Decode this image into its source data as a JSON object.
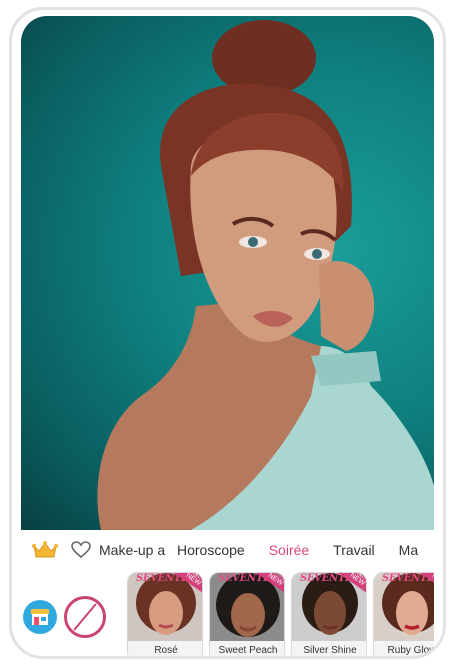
{
  "categories": {
    "tabs": [
      {
        "label": "Make-up artist",
        "active": false
      },
      {
        "label": "Horoscope",
        "active": false
      },
      {
        "label": "Soirée",
        "active": true
      },
      {
        "label": "Travail",
        "active": false
      },
      {
        "label": "Ma",
        "active": false
      }
    ],
    "crown_icon": "crown-icon",
    "favorites_icon": "heart-outline-icon"
  },
  "looks": {
    "shop_icon": "store-icon",
    "none_icon": "no-makeup-icon",
    "items": [
      {
        "name": "Rosé",
        "brand": "SEVENTEEN",
        "badge": "NEW"
      },
      {
        "name": "Sweet Peach",
        "brand": "SEVENTEEN",
        "badge": "NEW"
      },
      {
        "name": "Silver Shine",
        "brand": "SEVENTEEN",
        "badge": "NEW"
      },
      {
        "name": "Ruby Glow",
        "brand": "SEVENTEEN",
        "badge": "NEW"
      }
    ]
  },
  "colors": {
    "accent": "#d84a7e",
    "shop": "#31a8e0",
    "photo_background": "#0f7f7e"
  }
}
